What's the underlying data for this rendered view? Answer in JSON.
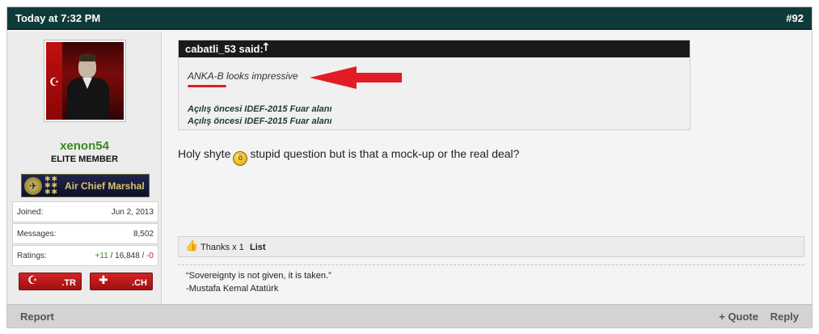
{
  "post": {
    "date": "Today at 7:32 PM",
    "number": "#92"
  },
  "user": {
    "name": "xenon54",
    "title": "ELITE MEMBER",
    "rank_label": "Air Chief Marshal",
    "stats": [
      {
        "label": "Joined:",
        "value": "Jun 2, 2013"
      },
      {
        "label": "Messages:",
        "value": "8,502"
      },
      {
        "label": "Ratings:",
        "value_plus": "+11",
        "value_mid": " / 16,848 / ",
        "value_minus": "-0"
      }
    ],
    "flags": [
      {
        "code": ".TR",
        "symbol": "☪"
      },
      {
        "code": ".CH",
        "symbol": "✚"
      }
    ]
  },
  "quote": {
    "author": "cabatli_53 said:",
    "arrow": "↑",
    "text": "ANKA-B looks impressive",
    "lines": [
      "Açılış öncesi IDEF-2015 Fuar alanı",
      "Açılış öncesi IDEF-2015 Fuar alanı"
    ]
  },
  "message": {
    "before_smiley": "Holy shyte",
    "after_smiley": "stupid question but is that a mock-up or the real deal?"
  },
  "thanks": {
    "text": "Thanks x 1",
    "list_label": "List"
  },
  "signature": {
    "line1": "“Sovereignty is not given, it is taken.”",
    "line2": "-Mustafa Kemal Atatürk"
  },
  "footer": {
    "report_label": "Report",
    "quote_label": "+ Quote",
    "reply_label": "Reply"
  },
  "colors": {
    "header_bg": "#0e3b3a",
    "username": "#3a8a1e",
    "annotation_red": "#e11c24"
  }
}
